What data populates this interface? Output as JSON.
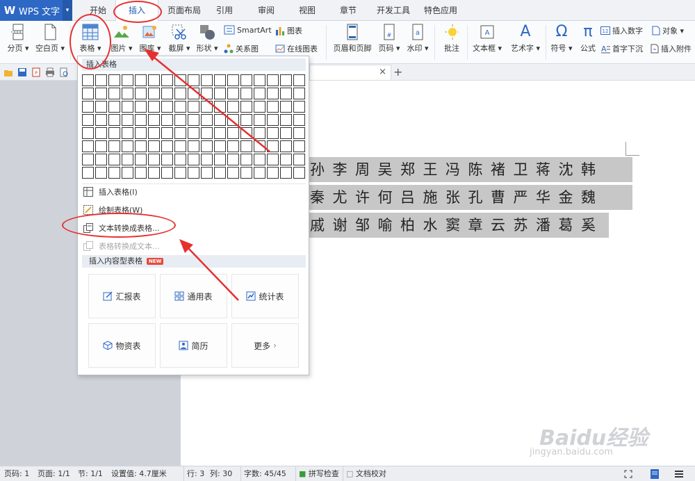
{
  "app": {
    "name": "WPS 文字",
    "logo_letter": "W"
  },
  "menu_tabs": [
    "开始",
    "插入",
    "页面布局",
    "引用",
    "审阅",
    "视图",
    "章节",
    "开发工具",
    "特色应用"
  ],
  "ribbon": {
    "page_break": "分页",
    "blank_page": "空白页",
    "table": "表格",
    "picture": "图片",
    "gallery": "图库",
    "screenshot": "截屏",
    "shapes": "形状",
    "smartart": "SmartArt",
    "chart": "图表",
    "relation_chart": "关系图",
    "online_chart": "在线图表",
    "header_footer": "页眉和页脚",
    "page_number": "页码",
    "watermark": "水印",
    "comment": "批注",
    "text_box": "文本框",
    "word_art": "艺术字",
    "symbol": "符号",
    "formula": "公式",
    "insert_number": "插入数字",
    "object": "对象",
    "drop_cap": "首字下沉",
    "insert_attachment": "插入附件",
    "symbol_glyph": "Ω",
    "formula_glyph": "π",
    "wordart_glyph": "A"
  },
  "dropdown": {
    "header": "插入表格",
    "insert_table": "插入表格(I)",
    "draw_table": "绘制表格(W)",
    "text_to_table": "文本转换成表格...",
    "table_to_text": "表格转换成文本...",
    "content_tables_header": "插入内容型表格",
    "new_badge": "NEW",
    "cards": [
      "汇报表",
      "通用表",
      "统计表",
      "物资表",
      "简历",
      "更多"
    ]
  },
  "document": {
    "lines": [
      "孙李周吴郑王冯陈褚卫蒋沈韩",
      "秦尤许何吕施张孔曹严华金魏",
      "戚谢邹喻柏水窦章云苏潘葛奚"
    ]
  },
  "doc_tab": {
    "close": "×",
    "add": "+"
  },
  "status": {
    "page_code": "页码: 1",
    "page": "页面: 1/1",
    "section": "节: 1/1",
    "setting": "设置值: 4.7厘米",
    "row": "行: 3",
    "col": "列: 30",
    "word_count": "字数: 45/45",
    "spell_check": "拼写检查",
    "doc_proof": "文档校对"
  },
  "watermark": {
    "brand": "Baidu经验",
    "url": "jingyan.baidu.com"
  },
  "colors": {
    "accent": "#2d68c4",
    "annotation": "#e53030"
  }
}
